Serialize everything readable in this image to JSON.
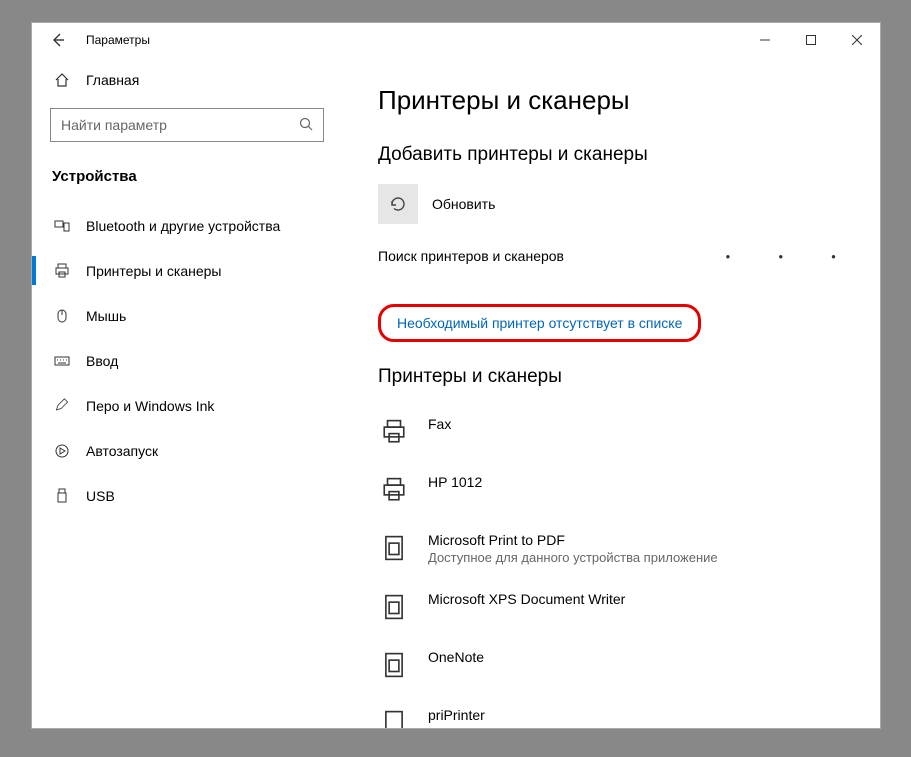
{
  "window": {
    "title": "Параметры"
  },
  "sidebar": {
    "home": "Главная",
    "search_placeholder": "Найти параметр",
    "category": "Устройства",
    "items": [
      {
        "label": "Bluetooth и другие устройства"
      },
      {
        "label": "Принтеры и сканеры"
      },
      {
        "label": "Мышь"
      },
      {
        "label": "Ввод"
      },
      {
        "label": "Перо и Windows Ink"
      },
      {
        "label": "Автозапуск"
      },
      {
        "label": "USB"
      }
    ]
  },
  "main": {
    "title": "Принтеры и сканеры",
    "add_section": "Добавить принтеры и сканеры",
    "refresh": "Обновить",
    "searching": "Поиск принтеров и сканеров",
    "missing_link": "Необходимый принтер отсутствует в списке",
    "list_section": "Принтеры и сканеры",
    "printers": [
      {
        "name": "Fax",
        "sub": ""
      },
      {
        "name": "HP 1012",
        "sub": ""
      },
      {
        "name": "Microsoft Print to PDF",
        "sub": "Доступное для данного устройства приложение"
      },
      {
        "name": "Microsoft XPS Document Writer",
        "sub": ""
      },
      {
        "name": "OneNote",
        "sub": ""
      },
      {
        "name": "priPrinter",
        "sub": ""
      }
    ]
  }
}
